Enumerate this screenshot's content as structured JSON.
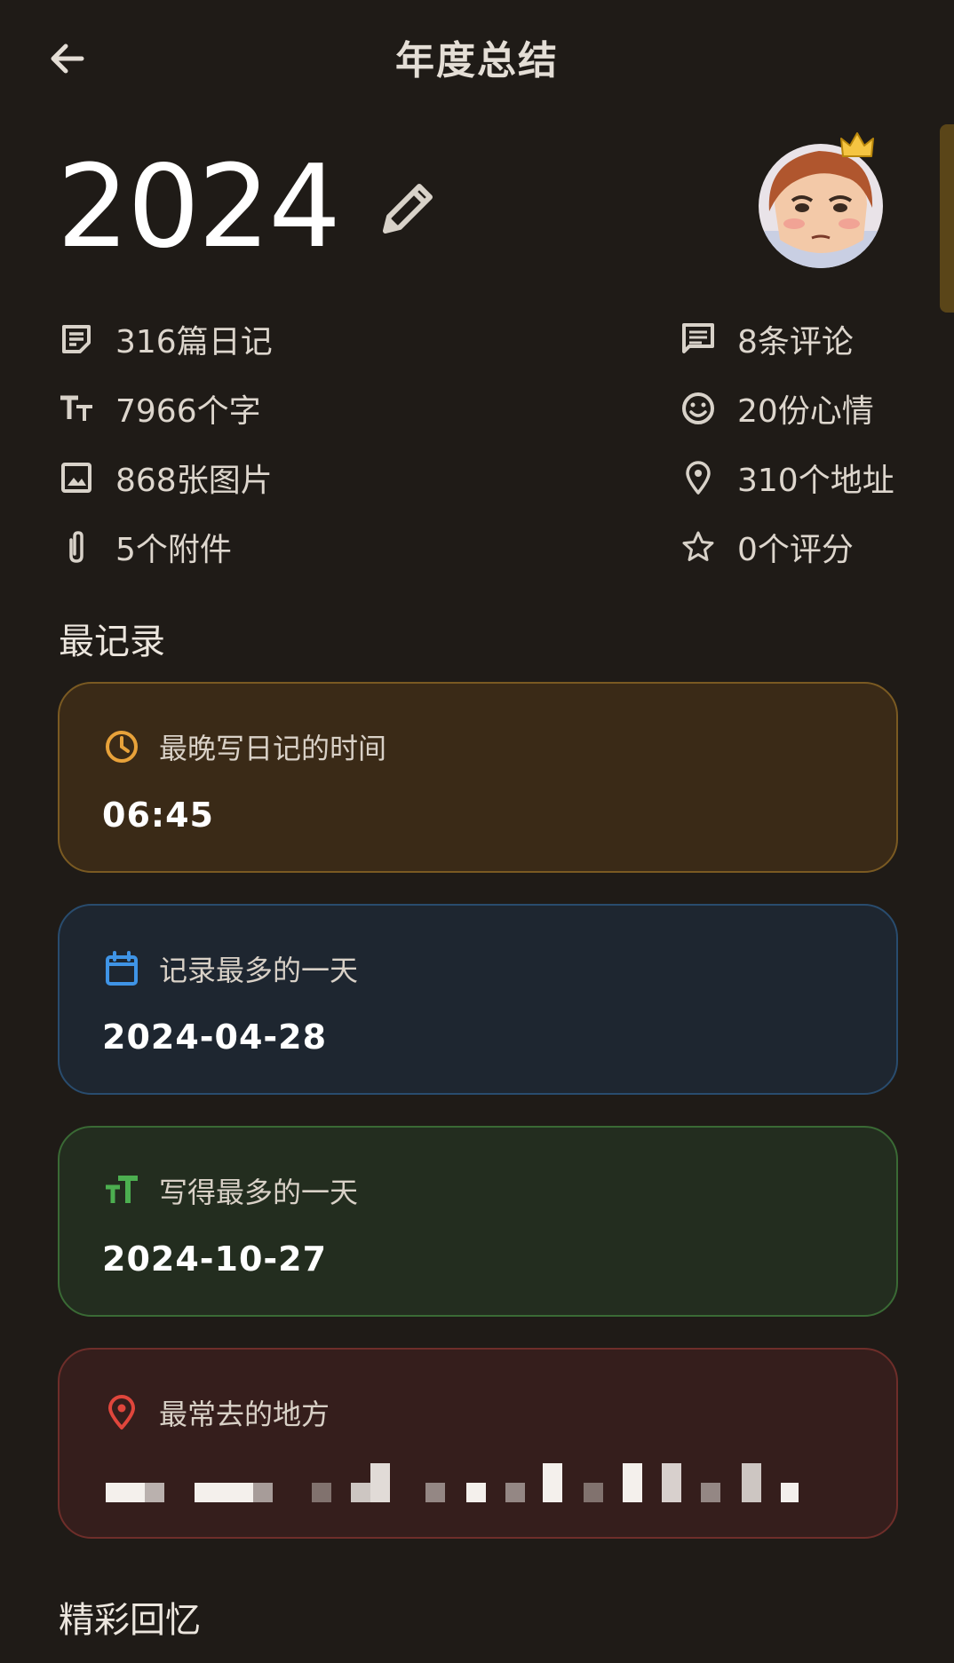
{
  "header": {
    "title": "年度总结",
    "back_icon": "arrow-left-icon"
  },
  "summary": {
    "year": "2024"
  },
  "stats_left": [
    {
      "icon": "notes-icon",
      "label": "316篇日记"
    },
    {
      "icon": "text-size-icon",
      "label": "7966个字"
    },
    {
      "icon": "image-icon",
      "label": "868张图片"
    },
    {
      "icon": "paperclip-icon",
      "label": "5个附件"
    }
  ],
  "stats_right": [
    {
      "icon": "comment-icon",
      "label": "8条评论"
    },
    {
      "icon": "smile-icon",
      "label": "20份心情"
    },
    {
      "icon": "location-pin-icon",
      "label": "310个地址"
    },
    {
      "icon": "star-icon",
      "label": "0个评分"
    }
  ],
  "records": {
    "section_title": "最记录",
    "cards": [
      {
        "icon": "clock-icon",
        "label": "最晚写日记的时间",
        "value": "06:45",
        "accent": "#e8a23a"
      },
      {
        "icon": "calendar-icon",
        "label": "记录最多的一天",
        "value": "2024-04-28",
        "accent": "#3f94e6"
      },
      {
        "icon": "text-size-icon",
        "label": "写得最多的一天",
        "value": "2024-10-27",
        "accent": "#4caf50"
      },
      {
        "icon": "location-pin-icon",
        "label": "最常去的地方",
        "value": "",
        "accent": "#e0463c"
      }
    ]
  },
  "memories": {
    "section_title": "精彩回忆"
  }
}
